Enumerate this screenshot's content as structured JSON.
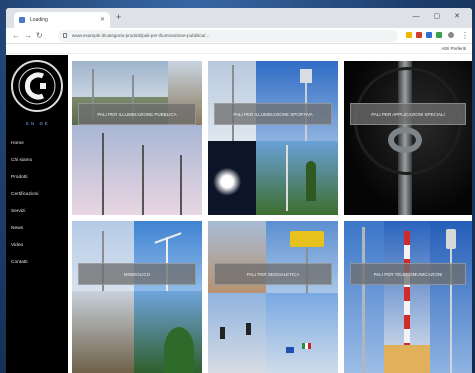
{
  "browser": {
    "tab_title": "Loading",
    "new_tab_icon": "plus-icon",
    "url": "www.example.it/categoria-prodotti/pali-per-illuminazione-pubblica/...",
    "bookmark": "Altri Preferiti",
    "window_controls": "— ▢ ✕"
  },
  "sidebar": {
    "lang": "EN   DE",
    "menu": [
      "Home",
      "Chi siamo",
      "Prodotti",
      "Certificazioni",
      "Servizi",
      "News",
      "Video",
      "Contatti"
    ]
  },
  "tiles": [
    {
      "label": "PALI PER ILLUMINAZIONE PUBBLICA"
    },
    {
      "label": "PALI PER ILLUMINAZIONE SPORTIVA"
    },
    {
      "label": "PALI PER APPLICAZIONI SPECIALI"
    },
    {
      "label": "MINIEOLICO"
    },
    {
      "label": "PALI PER SEGNALETICA"
    },
    {
      "label": "PALI PER TELECOMUNICAZIONI"
    }
  ],
  "colors": {
    "sidebar_bg": "#000000",
    "overlay": "#6e6e6e",
    "lang_link": "#7aa2e8"
  }
}
